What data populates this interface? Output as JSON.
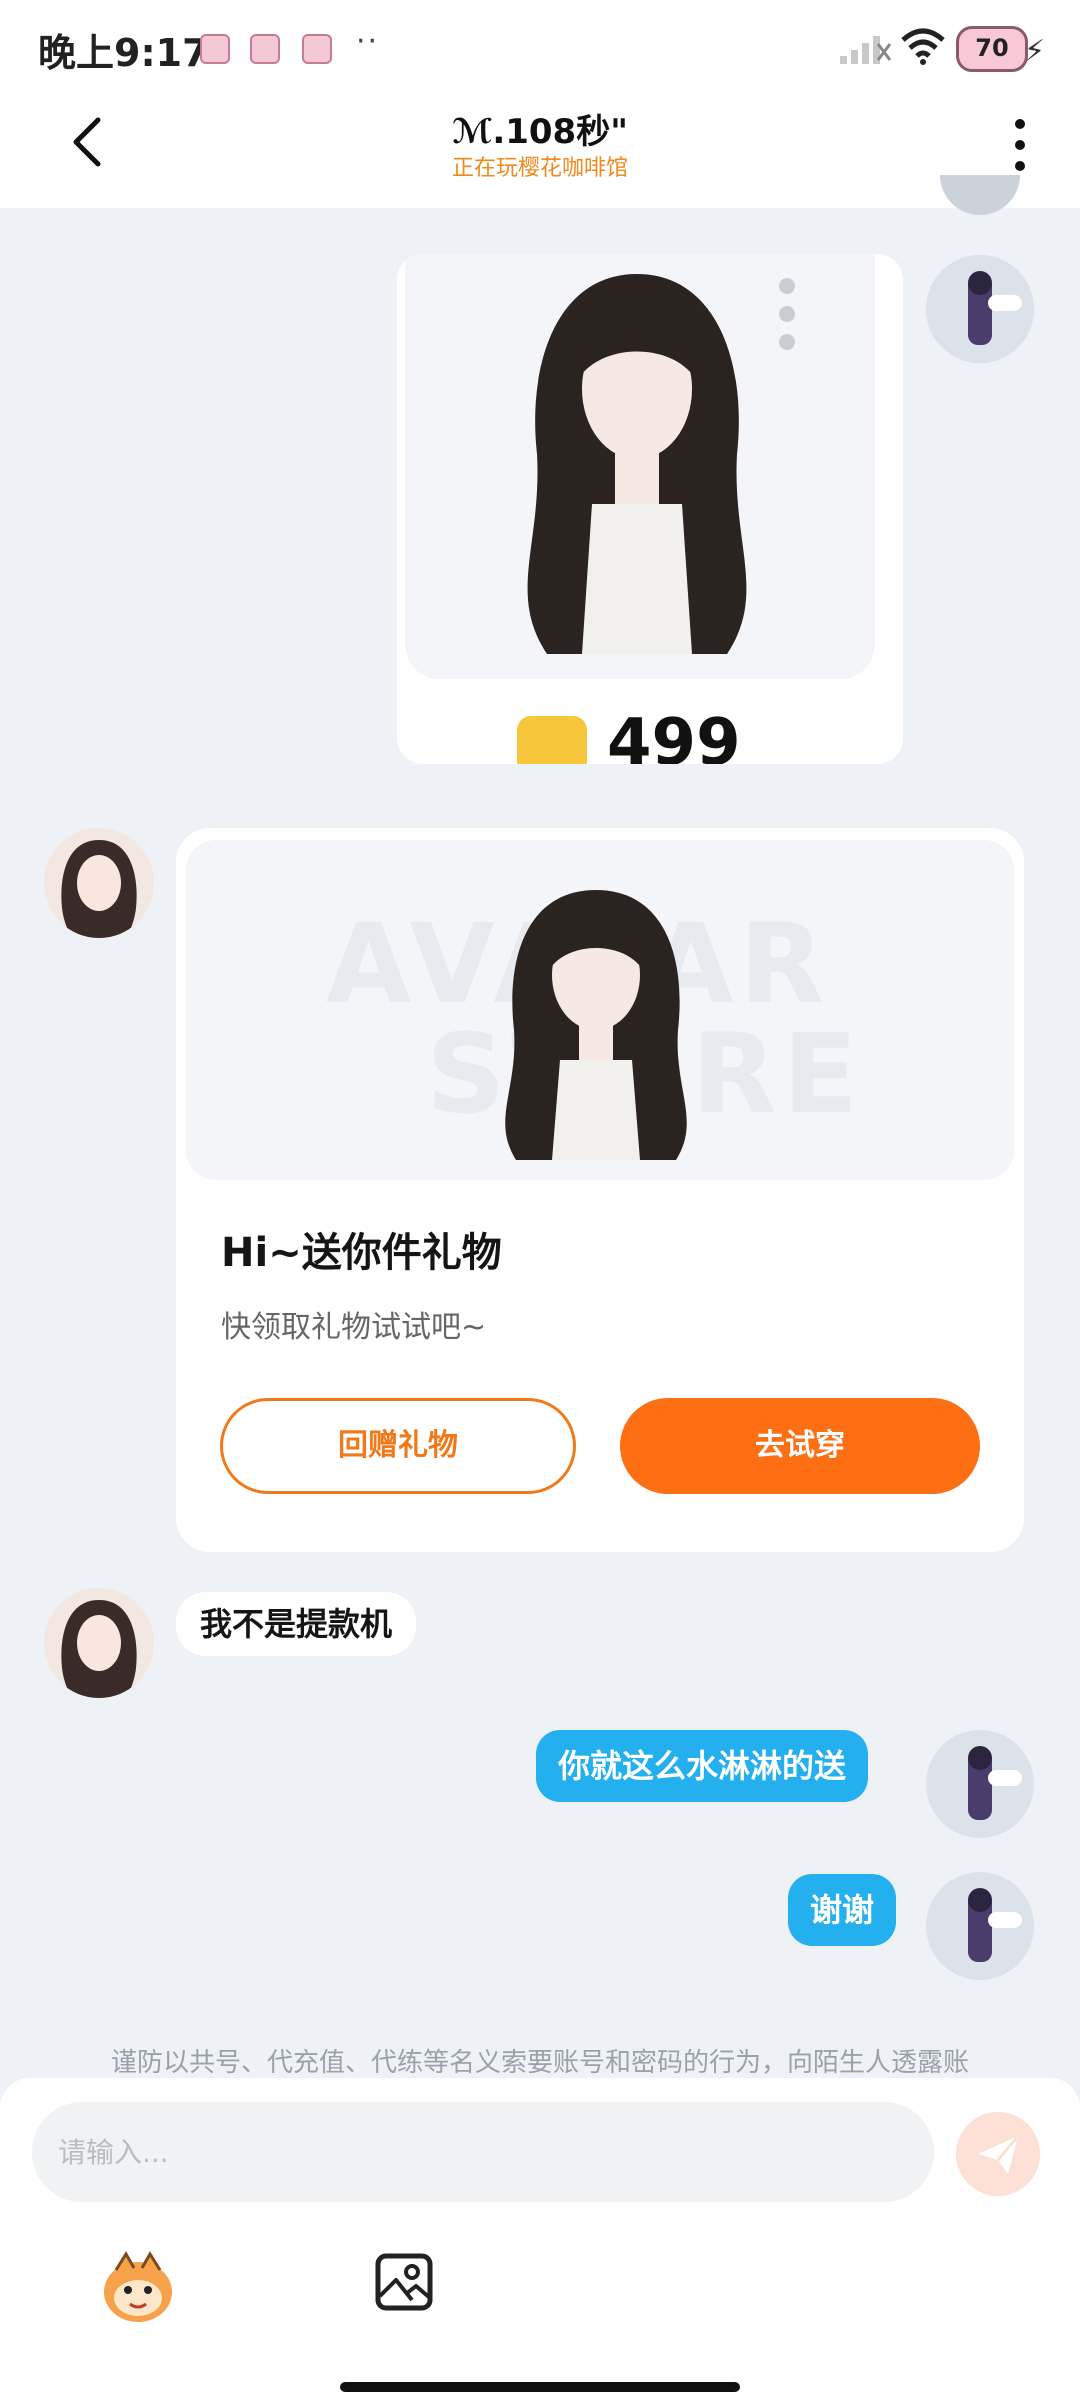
{
  "status_bar": {
    "time": "晚上9:17",
    "dots": "··",
    "battery": "70"
  },
  "header": {
    "title": "ℳ.108秒\"",
    "subtitle": "正在玩樱花咖啡馆"
  },
  "gift_out": {
    "price": "499"
  },
  "gift_in": {
    "title": "Hi~送你件礼物",
    "subtitle": "快领取礼物试试吧~",
    "return_gift_label": "回赠礼物",
    "try_on_label": "去试穿",
    "watermark": "AVATAR STORE"
  },
  "messages": [
    {
      "direction": "in",
      "text": "我不是提款机"
    },
    {
      "direction": "out",
      "text": "你就这么水淋淋的送"
    },
    {
      "direction": "out",
      "text": "谢谢"
    }
  ],
  "notice": "谨防以共号、代充值、代练等名义索要账号和密码的行为，向陌生人透露账",
  "input": {
    "placeholder": "请输入..."
  },
  "colors": {
    "accent_orange": "#fd6f12",
    "outgoing_bubble": "#24b0ee",
    "subtitle_orange": "#f08a1a"
  },
  "icons": [
    "back-icon",
    "more-icon",
    "send-icon",
    "emoji-icon",
    "image-icon",
    "signal-icon",
    "wifi-icon",
    "battery-icon"
  ]
}
